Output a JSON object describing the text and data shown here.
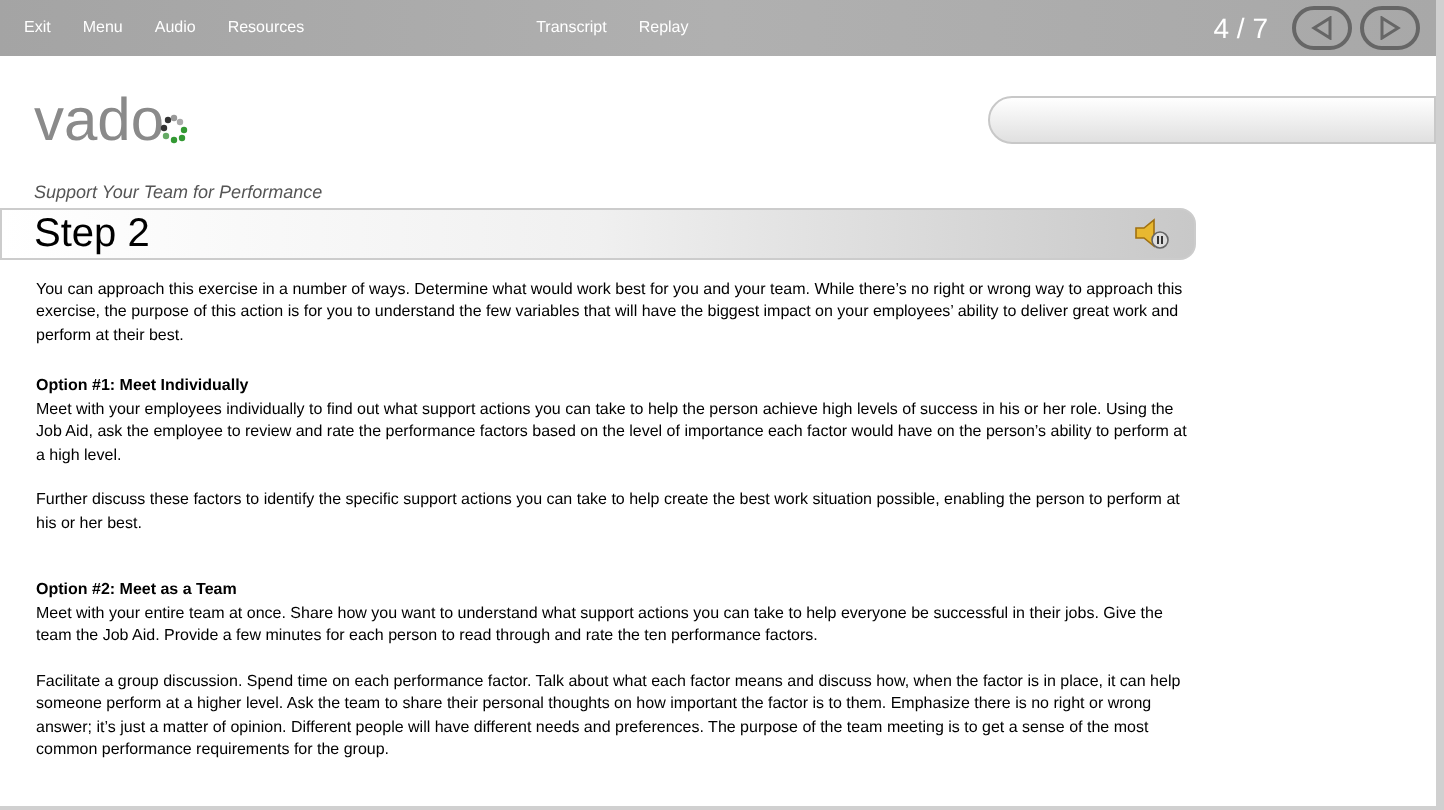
{
  "menu": [
    "Exit",
    "Menu",
    "Audio",
    "Resources",
    "Transcript",
    "Replay"
  ],
  "page_counter": "4 / 7",
  "logo": "vado",
  "subtitle": "Support Your Team for Performance",
  "step_title": "Step 2",
  "content": [
    {
      "kind": "paragraph",
      "text": "You can approach this exercise in a number of ways. Determine what would work best for you and your team. While there’s no right or wrong way to approach this exercise, the purpose of this action is for you to understand the few variables that will have the biggest impact on your employees’ ability to deliver great work and perform at their best."
    },
    {
      "kind": "section",
      "heading": "Option #1: Meet Individually",
      "paragraphs": [
        "Meet with your employees individually to find out what support actions you can take to help the person achieve high levels of success in his or her role. Using the Job Aid, ask the employee to review and rate the performance factors based on the level of importance each factor would have on the person’s ability to perform at a high level.",
        "Further discuss these factors to identify the specific support actions you can take to help create the best work situation possible, enabling the person to perform at his or her best."
      ]
    },
    {
      "kind": "section",
      "heading": "Option #2: Meet as a Team",
      "paragraphs": [
        "Meet with your entire team at once. Share how you want to understand what support actions you can take to help everyone be successful in their jobs. Give the team the Job Aid. Provide a few minutes for each person to read through and rate the ten performance factors.",
        "Facilitate a group discussion. Spend time on each performance factor. Talk about what each factor means and discuss how, when the factor is in place, it can help someone perform at a higher level. Ask the team to share their personal thoughts on how important the factor is to them. Emphasize there is no right or wrong answer; it’s just a matter of opinion. Different people will have different needs and preferences. The purpose of the team meeting is to get a sense of the most common performance requirements for the group."
      ]
    }
  ]
}
